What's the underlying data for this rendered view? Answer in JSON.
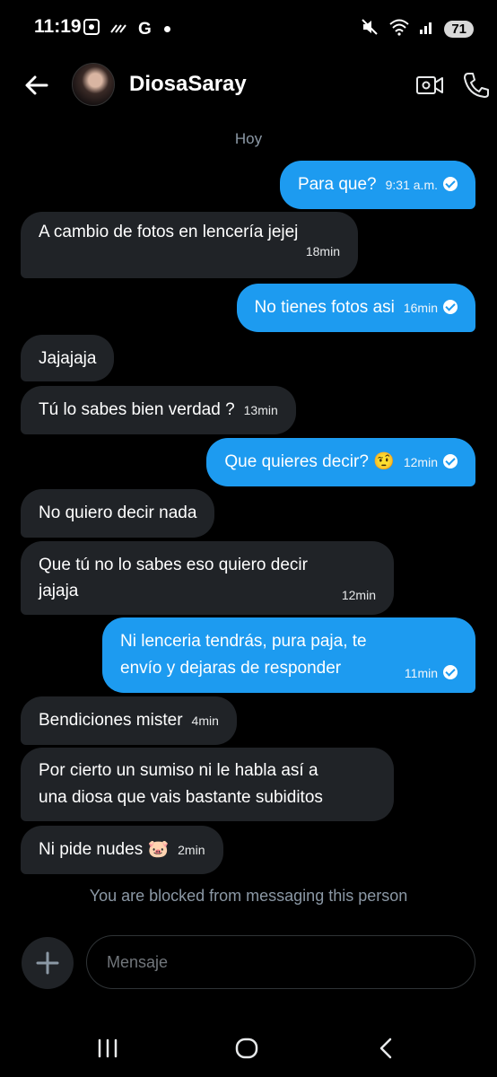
{
  "status": {
    "time": "11:19",
    "carrier_glyph": "G",
    "battery": "71"
  },
  "header": {
    "name": "DiosaSaray"
  },
  "date_label": "Hoy",
  "messages": [
    {
      "text": "Para que?",
      "time": "9:31 a.m."
    },
    {
      "text": "A cambio de fotos en lencería jejej",
      "time": "18min"
    },
    {
      "text": "No tienes fotos asi",
      "time": "16min"
    },
    {
      "text": "Jajajaja",
      "time": ""
    },
    {
      "text": "Tú lo sabes bien verdad ?",
      "time": "13min"
    },
    {
      "text": "Que quieres decir? 🤨",
      "time": "12min"
    },
    {
      "text": "No quiero decir nada",
      "time": ""
    },
    {
      "line1": "Que tú no lo sabes eso quiero decir",
      "line2": "jajaja",
      "time": "12min"
    },
    {
      "line1": "Ni lenceria tendrás, pura paja, te",
      "line2": "envío y dejaras de responder",
      "time": "11min"
    },
    {
      "text": "Bendiciones mister",
      "time": "4min"
    },
    {
      "line1": "Por cierto un sumiso ni le habla así a",
      "line2": "una diosa que vais bastante subiditos"
    },
    {
      "text": "Ni pide nudes 🐷",
      "time": "2min"
    }
  ],
  "blocked_notice": "You are blocked from messaging this person",
  "composer": {
    "placeholder": "Mensaje"
  }
}
